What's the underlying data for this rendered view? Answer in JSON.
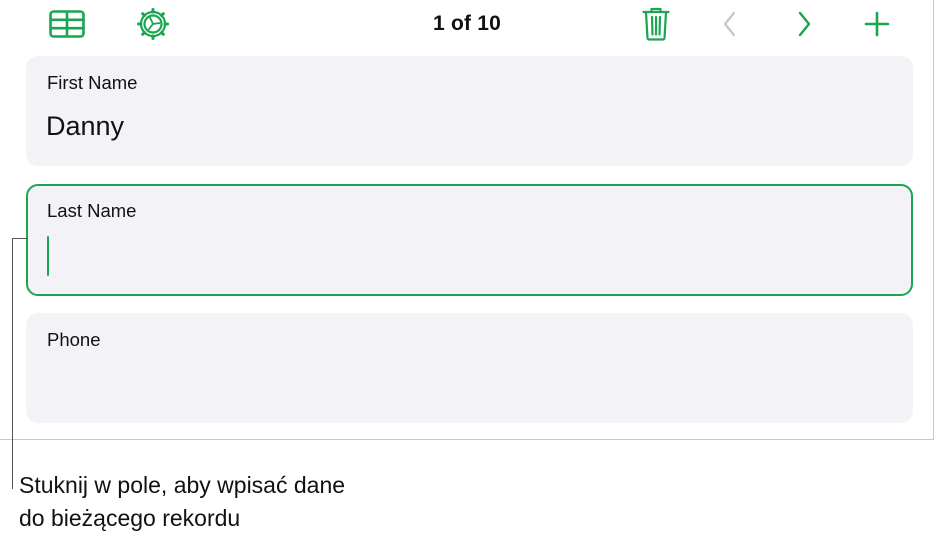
{
  "toolbar": {
    "record_counter": "1 of 10",
    "icons": {
      "table_view": "table-grid-icon",
      "settings": "gear-icon",
      "delete": "trash-icon",
      "previous": "chevron-left-icon",
      "next": "chevron-right-icon",
      "add": "plus-icon"
    }
  },
  "fields": [
    {
      "label": "First Name",
      "value": "Danny",
      "active": false
    },
    {
      "label": "Last Name",
      "value": "",
      "active": true
    },
    {
      "label": "Phone",
      "value": "",
      "active": false
    }
  ],
  "callout": {
    "line1": "Stuknij w pole, aby wpisać dane",
    "line2": "do bieżącego rekordu"
  },
  "colors": {
    "accent": "#1aa551",
    "disabled": "#c7c7cc",
    "card_bg": "#f3f3f7"
  }
}
